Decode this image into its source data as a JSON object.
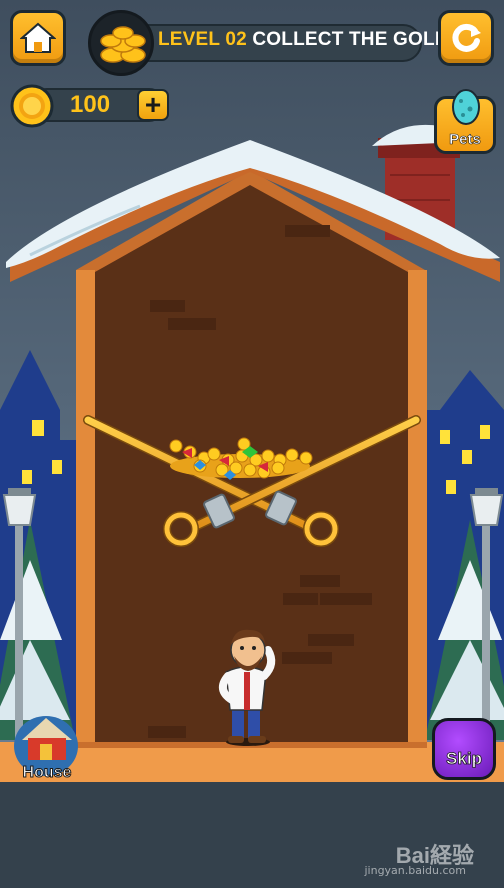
{
  "header": {
    "level_prefix": "LEVEL 02",
    "level_title": "COLLECT THE GOLD"
  },
  "coins": {
    "count": "100"
  },
  "buttons": {
    "pets_label": "Pets",
    "house_label": "House",
    "skip_label": "Skip"
  },
  "watermark": {
    "brand": "Bai経验",
    "url": "jingyan.baidu.com"
  },
  "colors": {
    "accent_orange": "#f5a81a",
    "gold_text": "#ffc21a",
    "panel_dark": "#34424c",
    "skip_purple": "#8a2be2"
  }
}
